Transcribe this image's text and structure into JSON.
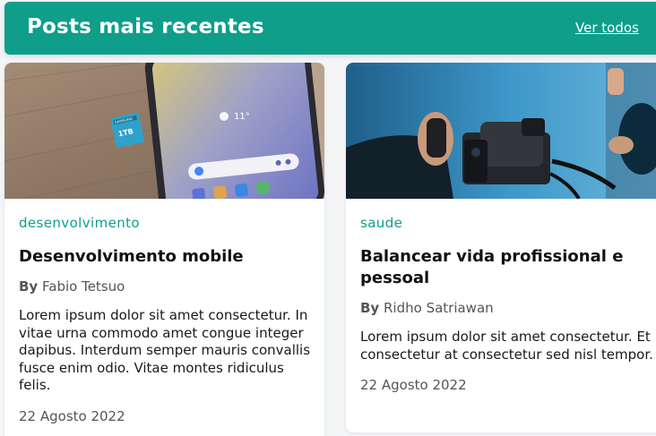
{
  "header": {
    "title": "Posts mais recentes",
    "view_all": "Ver todos"
  },
  "posts": [
    {
      "image_icon": "phone-and-memory-card-photo",
      "image_text": {
        "card_brand": "SAMSUNG",
        "card_capacity": "1TB",
        "weather": "11°"
      },
      "category": "desenvolvimento",
      "title": "Desenvolvimento mobile",
      "author_prefix": "By",
      "author": "Fabio Tetsuo",
      "excerpt": "Lorem ipsum dolor sit amet consectetur. In vitae urna commodo amet congue integer dapibus. Interdum semper mauris convallis fusce enim odio. Vitae montes ridiculus felis.",
      "date": "22 Agosto 2022"
    },
    {
      "image_icon": "phone-on-camera-rig-photo",
      "category": "saude",
      "title": "Balancear vida profissional e pessoal",
      "author_prefix": "By",
      "author": "Ridho Satriawan",
      "excerpt": "Lorem ipsum dolor sit amet consectetur. Et consectetur at consectetur sed nisl tempor.",
      "date": "22 Agosto 2022"
    }
  ],
  "colors": {
    "accent": "#0f9e8a",
    "card_background": "#ffffff",
    "page_background": "#f4f5f7"
  }
}
